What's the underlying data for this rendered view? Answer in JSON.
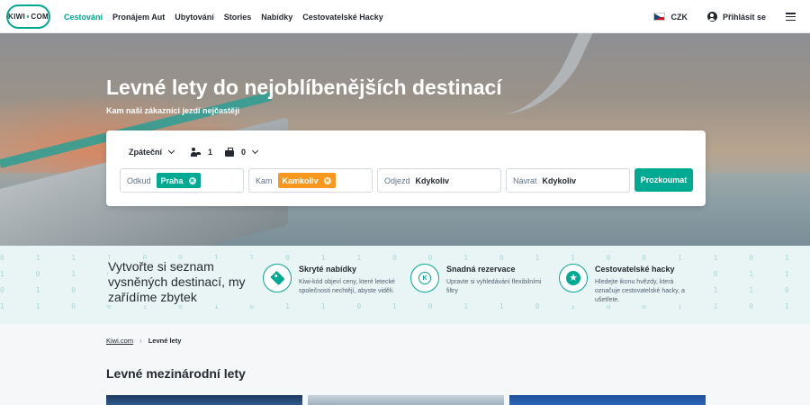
{
  "nav": {
    "logo_left": "KIWI",
    "logo_right": "COM",
    "links": [
      "Cestování",
      "Pronájem Aut",
      "Ubytování",
      "Stories",
      "Nabídky",
      "Cestovatelské Hacky"
    ],
    "currency": "CZK",
    "login": "Přihlásit se"
  },
  "hero": {
    "title": "Levné lety do nejoblíbenějších destinací",
    "subtitle": "Kam naši zákazníci jezdí nejčastěji"
  },
  "search": {
    "trip_type": "Zpáteční",
    "passengers": "1",
    "bags": "0",
    "from_label": "Odkud",
    "from_value": "Praha",
    "to_label": "Kam",
    "to_value": "Kamkoliv",
    "depart_label": "Odjezd",
    "depart_value": "Kdykoliv",
    "return_label": "Návrat",
    "return_value": "Kdykoliv",
    "button": "Prozkoumat"
  },
  "features": {
    "title": "Vytvořte si seznam vysněných destinací, my zařídíme zbytek",
    "items": [
      {
        "title": "Skryté nabídky",
        "text": "Kiwi-kód objeví ceny, které letecké společnosti nechtějí, abyste viděli.",
        "icon": "tag-icon"
      },
      {
        "title": "Snadná rezervace",
        "text": "Upravte si vyhledávání flexibilními filtry",
        "icon": "kiwi-coin-icon"
      },
      {
        "title": "Cestovatelské hacky",
        "text": "Hledejte ikonu hvězdy, která označuje cestovatelské hacky, a ušetřete.",
        "icon": "star-icon"
      }
    ]
  },
  "breadcrumb": {
    "home": "Kiwi.com",
    "current": "Levné lety"
  },
  "section": {
    "title": "Levné mezinárodní lety"
  },
  "colors": {
    "brand": "#00a991",
    "orange": "#f9971e",
    "text": "#252a31"
  }
}
